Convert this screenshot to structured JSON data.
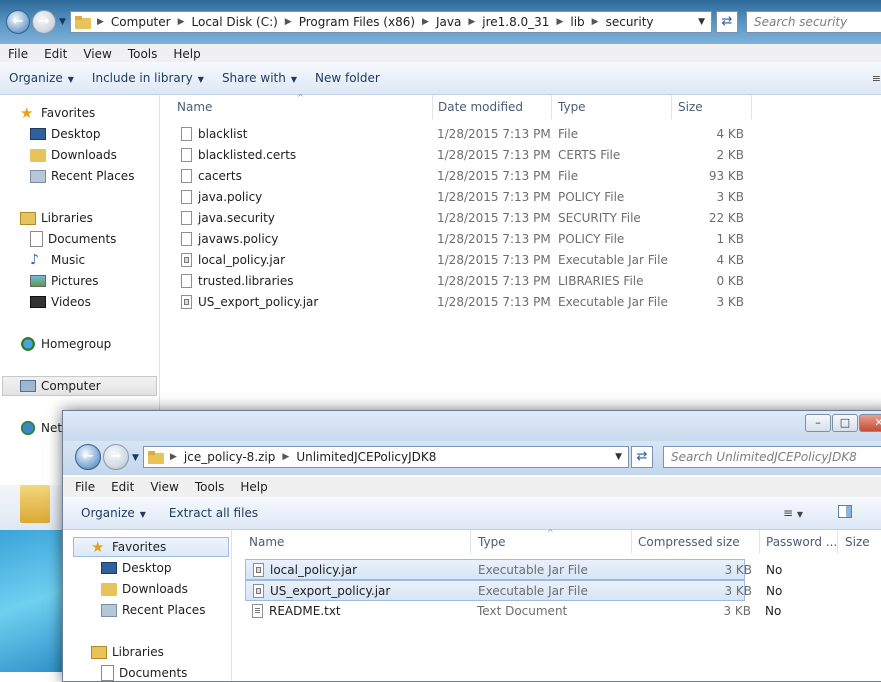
{
  "window1": {
    "breadcrumb": [
      "Computer",
      "Local Disk (C:)",
      "Program Files (x86)",
      "Java",
      "jre1.8.0_31",
      "lib",
      "security"
    ],
    "search_placeholder": "Search security",
    "menu": [
      "File",
      "Edit",
      "View",
      "Tools",
      "Help"
    ],
    "commands": {
      "organize": "Organize",
      "include": "Include in library",
      "share": "Share with",
      "newfolder": "New folder"
    },
    "columns": {
      "name": "Name",
      "date": "Date modified",
      "type": "Type",
      "size": "Size"
    },
    "nav": {
      "favorites": "Favorites",
      "desktop": "Desktop",
      "downloads": "Downloads",
      "recent": "Recent Places",
      "libraries": "Libraries",
      "documents": "Documents",
      "music": "Music",
      "pictures": "Pictures",
      "videos": "Videos",
      "homegroup": "Homegroup",
      "computer": "Computer",
      "network": "Network"
    },
    "files": [
      {
        "name": "blacklist",
        "date": "1/28/2015 7:13 PM",
        "type": "File",
        "size": "4 KB",
        "icon": "file-icon"
      },
      {
        "name": "blacklisted.certs",
        "date": "1/28/2015 7:13 PM",
        "type": "CERTS File",
        "size": "2 KB",
        "icon": "file-icon"
      },
      {
        "name": "cacerts",
        "date": "1/28/2015 7:13 PM",
        "type": "File",
        "size": "93 KB",
        "icon": "file-icon"
      },
      {
        "name": "java.policy",
        "date": "1/28/2015 7:13 PM",
        "type": "POLICY File",
        "size": "3 KB",
        "icon": "file-icon"
      },
      {
        "name": "java.security",
        "date": "1/28/2015 7:13 PM",
        "type": "SECURITY File",
        "size": "22 KB",
        "icon": "file-icon"
      },
      {
        "name": "javaws.policy",
        "date": "1/28/2015 7:13 PM",
        "type": "POLICY File",
        "size": "1 KB",
        "icon": "file-icon"
      },
      {
        "name": "local_policy.jar",
        "date": "1/28/2015 7:13 PM",
        "type": "Executable Jar File",
        "size": "4 KB",
        "icon": "jar-icon"
      },
      {
        "name": "trusted.libraries",
        "date": "1/28/2015 7:13 PM",
        "type": "LIBRARIES File",
        "size": "0 KB",
        "icon": "file-icon"
      },
      {
        "name": "US_export_policy.jar",
        "date": "1/28/2015 7:13 PM",
        "type": "Executable Jar File",
        "size": "3 KB",
        "icon": "jar-icon"
      }
    ]
  },
  "window2": {
    "breadcrumb": [
      "jce_policy-8.zip",
      "UnlimitedJCEPolicyJDK8"
    ],
    "search_placeholder": "Search UnlimitedJCEPolicyJDK8",
    "menu": [
      "File",
      "Edit",
      "View",
      "Tools",
      "Help"
    ],
    "commands": {
      "organize": "Organize",
      "extract": "Extract all files"
    },
    "columns": {
      "name": "Name",
      "type": "Type",
      "compressed": "Compressed size",
      "password": "Password ...",
      "size": "Size"
    },
    "nav": {
      "favorites": "Favorites",
      "desktop": "Desktop",
      "downloads": "Downloads",
      "recent": "Recent Places",
      "libraries": "Libraries",
      "documents": "Documents"
    },
    "files": [
      {
        "name": "local_policy.jar",
        "type": "Executable Jar File",
        "compressed": "3 KB",
        "password": "No",
        "selected": true
      },
      {
        "name": "US_export_policy.jar",
        "type": "Executable Jar File",
        "compressed": "3 KB",
        "password": "No",
        "selected": true
      },
      {
        "name": "README.txt",
        "type": "Text Document",
        "compressed": "3 KB",
        "password": "No",
        "selected": false
      }
    ]
  },
  "colors": {
    "addressbar": "#5b98c6",
    "selection": "#dce9f7",
    "folder": "#e8c35a"
  }
}
